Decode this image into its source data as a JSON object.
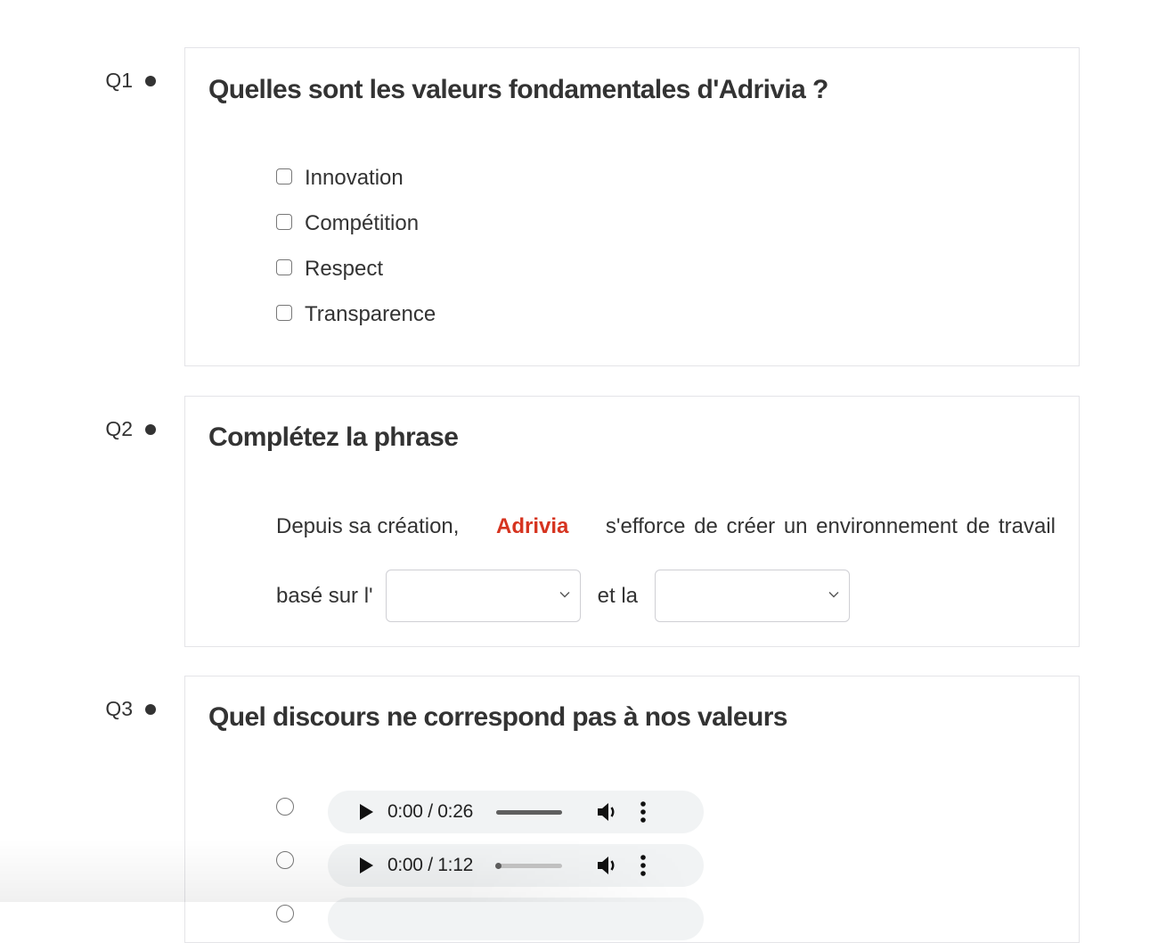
{
  "questions": [
    {
      "number": "Q1",
      "title": "Quelles sont les valeurs fondamentales d'Adrivia ?",
      "type": "checkbox",
      "options": [
        "Innovation",
        "Compétition",
        "Respect",
        "Transparence"
      ]
    },
    {
      "number": "Q2",
      "title": "Complétez la phrase",
      "type": "fill-in",
      "sentence": {
        "before_brand": "Depuis sa création,",
        "brand": "Adrivia",
        "after_brand": "s'efforce de créer un environnement de travail",
        "line2_start": "basé sur l'",
        "connector": "et la",
        "select1_value": "",
        "select2_value": ""
      },
      "brand_color": "#d63420"
    },
    {
      "number": "Q3",
      "title": "Quel discours ne correspond pas à nos valeurs",
      "type": "radio-audio",
      "options": [
        {
          "time": "0:00 / 0:26",
          "progress": 0,
          "buffered": 1.0
        },
        {
          "time": "0:00 / 1:12",
          "progress": 0,
          "buffered": 0
        }
      ]
    }
  ]
}
